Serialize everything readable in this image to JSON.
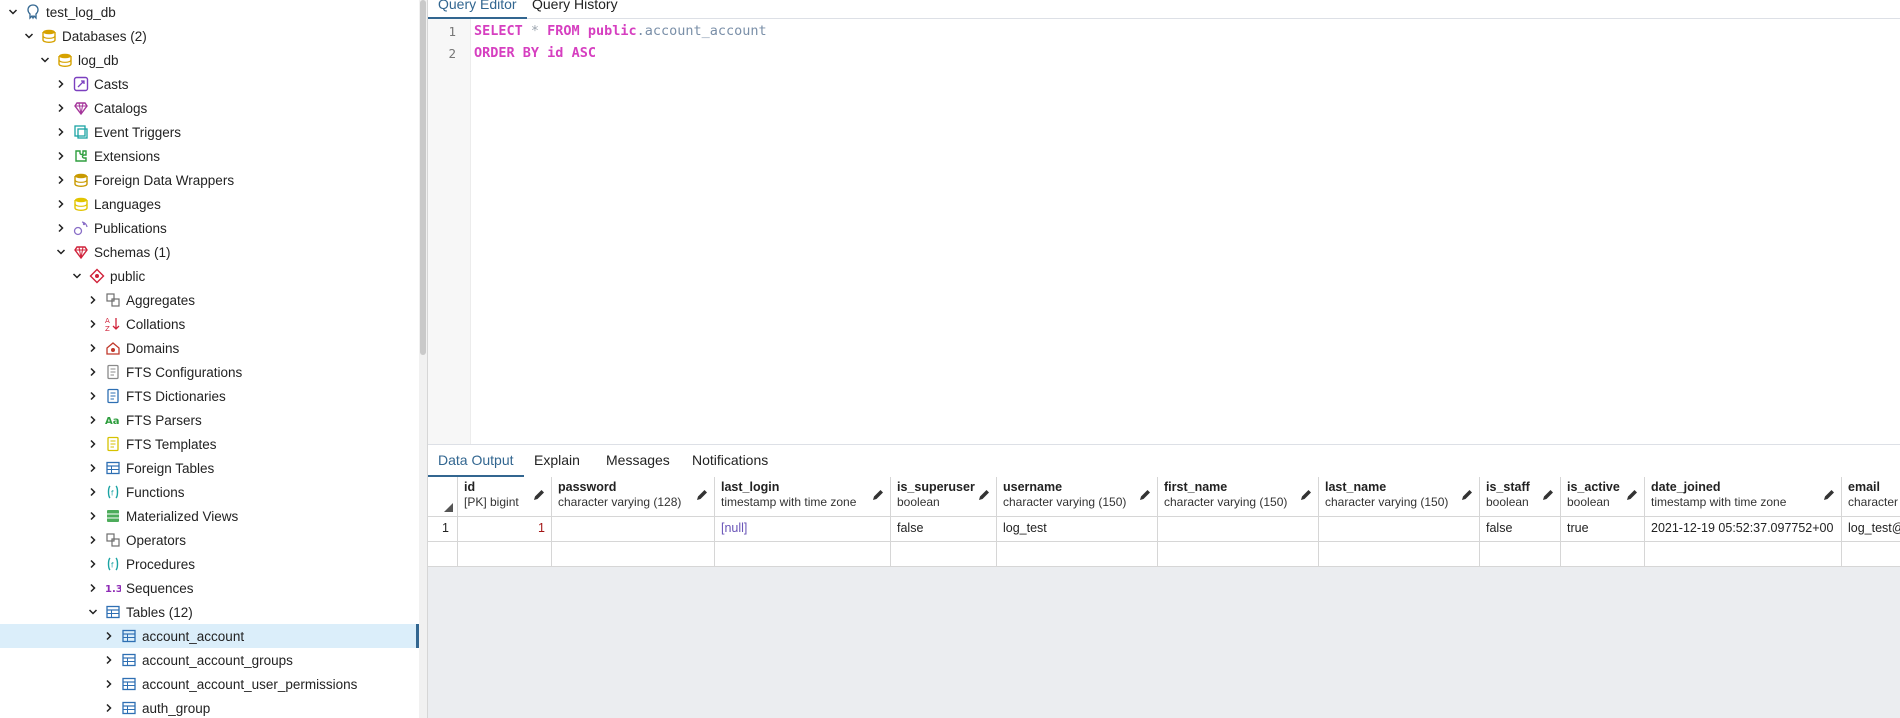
{
  "tree": [
    {
      "label": "test_log_db",
      "depth": 0,
      "expanded": true,
      "icon": "server-icon",
      "icon_color": "#336791"
    },
    {
      "label": "Databases (2)",
      "depth": 1,
      "expanded": true,
      "icon": "databases-icon",
      "icon_color": "#d6a200"
    },
    {
      "label": "log_db",
      "depth": 2,
      "expanded": true,
      "icon": "database-icon",
      "icon_color": "#d6a200"
    },
    {
      "label": "Casts",
      "depth": 3,
      "expanded": false,
      "icon": "casts-icon",
      "icon_color": "#7b3fbf"
    },
    {
      "label": "Catalogs",
      "depth": 3,
      "expanded": false,
      "icon": "catalogs-icon",
      "icon_color": "#a4349a"
    },
    {
      "label": "Event Triggers",
      "depth": 3,
      "expanded": false,
      "icon": "event-triggers-icon",
      "icon_color": "#1aa3a3"
    },
    {
      "label": "Extensions",
      "depth": 3,
      "expanded": false,
      "icon": "extensions-icon",
      "icon_color": "#2e9e3e"
    },
    {
      "label": "Foreign Data Wrappers",
      "depth": 3,
      "expanded": false,
      "icon": "foreign-data-wrappers-icon",
      "icon_color": "#c99a00"
    },
    {
      "label": "Languages",
      "depth": 3,
      "expanded": false,
      "icon": "languages-icon",
      "icon_color": "#e2c400"
    },
    {
      "label": "Publications",
      "depth": 3,
      "expanded": false,
      "icon": "publications-icon",
      "icon_color": "#8a6fc7"
    },
    {
      "label": "Schemas (1)",
      "depth": 3,
      "expanded": true,
      "icon": "schemas-icon",
      "icon_color": "#d0223a"
    },
    {
      "label": "public",
      "depth": 4,
      "expanded": true,
      "icon": "schema-icon",
      "icon_color": "#d0223a"
    },
    {
      "label": "Aggregates",
      "depth": 5,
      "expanded": false,
      "icon": "aggregates-icon",
      "icon_color": "#6d6d6d"
    },
    {
      "label": "Collations",
      "depth": 5,
      "expanded": false,
      "icon": "collations-icon",
      "icon_color": "#d0223a"
    },
    {
      "label": "Domains",
      "depth": 5,
      "expanded": false,
      "icon": "domains-icon",
      "icon_color": "#c0392b"
    },
    {
      "label": "FTS Configurations",
      "depth": 5,
      "expanded": false,
      "icon": "fts-configurations-icon",
      "icon_color": "#8a8a8a"
    },
    {
      "label": "FTS Dictionaries",
      "depth": 5,
      "expanded": false,
      "icon": "fts-dictionaries-icon",
      "icon_color": "#2e6fb3"
    },
    {
      "label": "FTS Parsers",
      "depth": 5,
      "expanded": false,
      "icon": "fts-parsers-icon",
      "icon_color": "#2e9e3e"
    },
    {
      "label": "FTS Templates",
      "depth": 5,
      "expanded": false,
      "icon": "fts-templates-icon",
      "icon_color": "#d6c200"
    },
    {
      "label": "Foreign Tables",
      "depth": 5,
      "expanded": false,
      "icon": "foreign-tables-icon",
      "icon_color": "#2e6fb3"
    },
    {
      "label": "Functions",
      "depth": 5,
      "expanded": false,
      "icon": "functions-icon",
      "icon_color": "#1aa3a3"
    },
    {
      "label": "Materialized Views",
      "depth": 5,
      "expanded": false,
      "icon": "materialized-views-icon",
      "icon_color": "#2e9e3e"
    },
    {
      "label": "Operators",
      "depth": 5,
      "expanded": false,
      "icon": "operators-icon",
      "icon_color": "#6d6d6d"
    },
    {
      "label": "Procedures",
      "depth": 5,
      "expanded": false,
      "icon": "procedures-icon",
      "icon_color": "#1aa3a3"
    },
    {
      "label": "Sequences",
      "depth": 5,
      "expanded": false,
      "icon": "sequences-icon",
      "icon_color": "#8e2bb5"
    },
    {
      "label": "Tables (12)",
      "depth": 5,
      "expanded": true,
      "icon": "tables-icon",
      "icon_color": "#2e6fb3"
    },
    {
      "label": "account_account",
      "depth": 6,
      "expanded": false,
      "icon": "table-icon",
      "icon_color": "#2e6fb3",
      "selected": true
    },
    {
      "label": "account_account_groups",
      "depth": 6,
      "expanded": false,
      "icon": "table-icon",
      "icon_color": "#2e6fb3"
    },
    {
      "label": "account_account_user_permissions",
      "depth": 6,
      "expanded": false,
      "icon": "table-icon",
      "icon_color": "#2e6fb3"
    },
    {
      "label": "auth_group",
      "depth": 6,
      "expanded": false,
      "icon": "table-icon",
      "icon_color": "#2e6fb3"
    }
  ],
  "editor_tabs": [
    "Query Editor",
    "Query History"
  ],
  "query_lines": [
    [
      {
        "t": "SELECT",
        "c": "kw"
      },
      {
        "t": " * ",
        "c": "op"
      },
      {
        "t": "FROM",
        "c": "kw"
      },
      {
        "t": " "
      },
      {
        "t": "public",
        "c": "kw"
      },
      {
        "t": ".account_account",
        "c": "ident"
      }
    ],
    [
      {
        "t": "ORDER BY",
        "c": "kw"
      },
      {
        "t": " "
      },
      {
        "t": "id",
        "c": "kw"
      },
      {
        "t": " "
      },
      {
        "t": "ASC",
        "c": "kw"
      }
    ]
  ],
  "result_tabs": [
    "Data Output",
    "Explain",
    "Messages",
    "Notifications"
  ],
  "columns": [
    {
      "name": "id",
      "type": "[PK] bigint"
    },
    {
      "name": "password",
      "type": "character varying (128)"
    },
    {
      "name": "last_login",
      "type": "timestamp with time zone"
    },
    {
      "name": "is_superuser",
      "type": "boolean"
    },
    {
      "name": "username",
      "type": "character varying (150)"
    },
    {
      "name": "first_name",
      "type": "character varying (150)"
    },
    {
      "name": "last_name",
      "type": "character varying (150)"
    },
    {
      "name": "is_staff",
      "type": "boolean"
    },
    {
      "name": "is_active",
      "type": "boolean"
    },
    {
      "name": "date_joined",
      "type": "timestamp with time zone"
    },
    {
      "name": "email",
      "type": "character v"
    }
  ],
  "rows": [
    {
      "rownum": "1",
      "cells": [
        "1",
        "",
        "[null]",
        "false",
        "log_test",
        "",
        "",
        "false",
        "true",
        "2021-12-19 05:52:37.097752+00",
        "log_test@e"
      ]
    }
  ],
  "colors": {
    "accent": "#326690",
    "selected_bg": "#dbeefa",
    "keyword": "#d63fc0",
    "null_text": "#6a55b8",
    "number_text": "#a31515"
  }
}
